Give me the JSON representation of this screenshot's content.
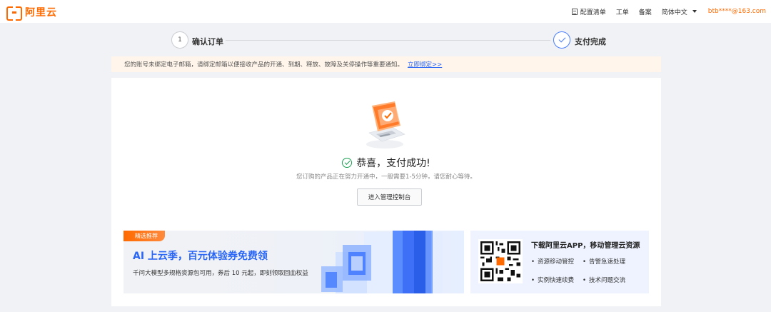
{
  "brand": {
    "logo_text": "阿里云",
    "accent": "#ff6a00"
  },
  "nav": {
    "items": [
      "配置清单",
      "工单",
      "备案",
      "简体中文"
    ],
    "user_email": "btb****@163.com"
  },
  "steps": [
    {
      "number": "1",
      "label": "确认订单"
    },
    {
      "label": "支付完成"
    }
  ],
  "notice": {
    "text": "您的账号未绑定电子邮箱，请绑定邮箱以便接收产品的开通、到期、释放、故障及关停操作等重要通知。",
    "link": "立即绑定>>"
  },
  "result": {
    "title": "恭喜，支付成功!",
    "subtitle": "您订购的产品正在努力开通中，一般需要1-5分钟，请您耐心等待。",
    "button": "进入管理控制台"
  },
  "promo": {
    "tag": "精选推荐",
    "title": "AI 上云季，百元体验券免费领",
    "desc": "千问大模型多规格资源包可用，券后 10 元起，即刻领取回血权益"
  },
  "app_panel": {
    "title": "下载阿里云APP，移动管理云资源",
    "features": [
      "资源移动管控",
      "告警急速处理",
      "实例快速续费",
      "技术问题交流"
    ]
  }
}
